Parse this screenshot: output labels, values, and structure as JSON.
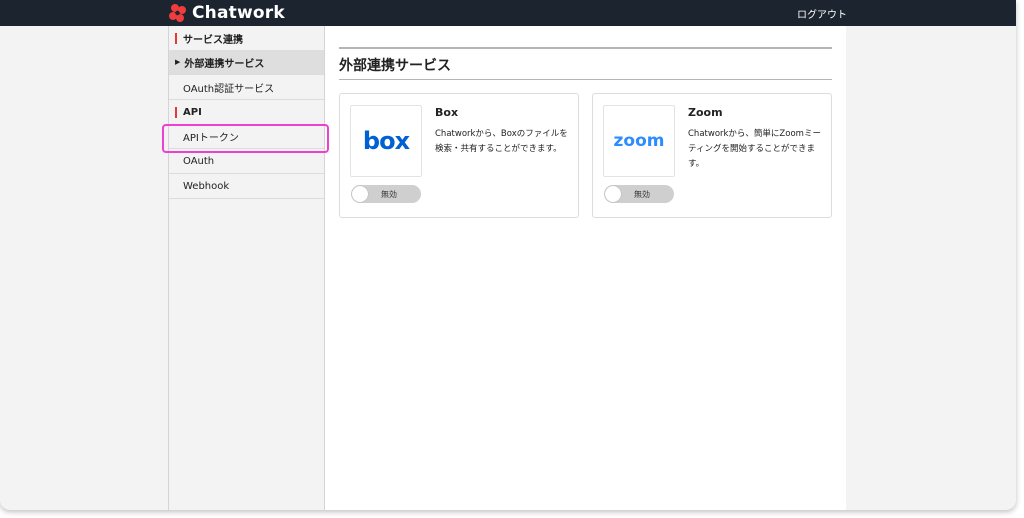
{
  "header": {
    "brand": "Chatwork",
    "logout_label": "ログアウト"
  },
  "sidebar": {
    "sections": [
      {
        "heading": "サービス連携",
        "items": [
          {
            "label": "外部連携サービス",
            "active": true
          },
          {
            "label": "OAuth認証サービス",
            "active": false
          }
        ]
      },
      {
        "heading": "API",
        "items": [
          {
            "label": "APIトークン",
            "active": false
          },
          {
            "label": "OAuth",
            "active": false
          },
          {
            "label": "Webhook",
            "active": false
          }
        ]
      }
    ]
  },
  "main": {
    "title": "外部連携サービス",
    "cards": [
      {
        "name": "Box",
        "logo_text": "box",
        "description": "Chatworkから、Boxのファイルを検索・共有することができます。",
        "toggle_label": "無効",
        "enabled": false
      },
      {
        "name": "Zoom",
        "logo_text": "zoom",
        "description": "Chatworkから、簡単にZoomミーティングを開始することができます。",
        "toggle_label": "無効",
        "enabled": false
      }
    ]
  },
  "colors": {
    "header_bg": "#1c2430",
    "accent_red": "#e53935",
    "highlight": "#ee3fd1",
    "box_blue": "#0061d5",
    "zoom_blue": "#2d8cff"
  }
}
